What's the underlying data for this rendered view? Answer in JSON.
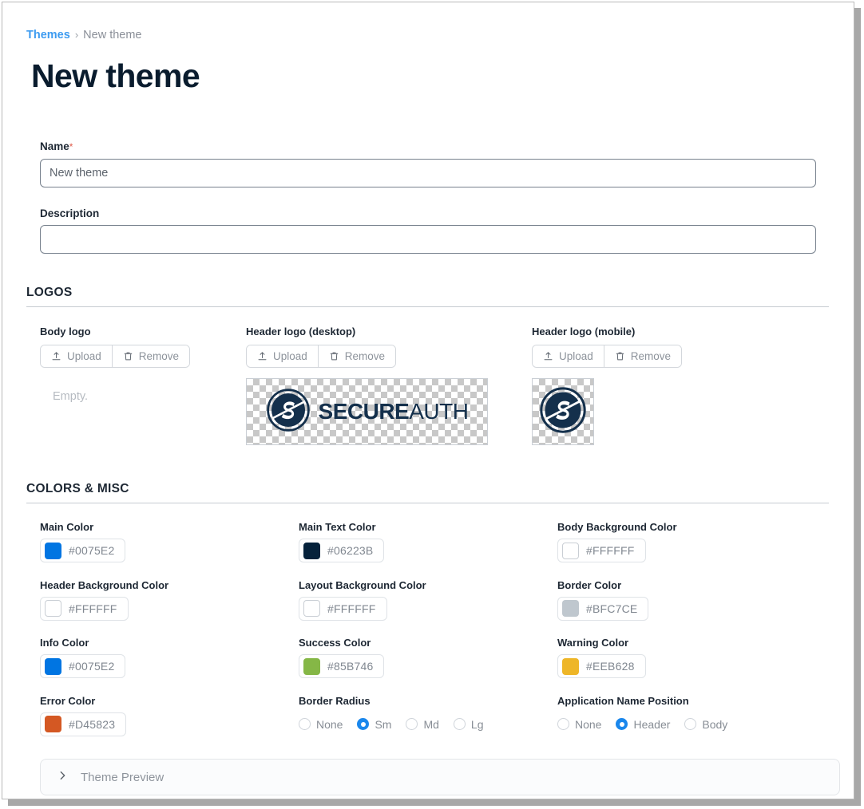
{
  "breadcrumb": {
    "link": "Themes",
    "separator": "›",
    "current": "New theme"
  },
  "page_title": "New theme",
  "form": {
    "name": {
      "label": "Name",
      "required_marker": "*",
      "value": "New theme",
      "placeholder": "New theme"
    },
    "description": {
      "label": "Description",
      "value": "",
      "placeholder": ""
    }
  },
  "logos_section": {
    "title": "LOGOS",
    "upload_label": "Upload",
    "remove_label": "Remove",
    "items": [
      {
        "label": "Body logo",
        "state": "Empty.",
        "preview": "none"
      },
      {
        "label": "Header logo (desktop)",
        "state": "",
        "preview": "wordmark"
      },
      {
        "label": "Header logo (mobile)",
        "state": "",
        "preview": "mark"
      }
    ],
    "wordmark": {
      "bold": "SECURE",
      "light": "AUTH",
      "color": "#14304C"
    }
  },
  "colors_section": {
    "title": "COLORS & MISC",
    "fields": [
      {
        "label": "Main Color",
        "value": "#0075E2",
        "swatch": "#0075E2"
      },
      {
        "label": "Main Text Color",
        "value": "#06223B",
        "swatch": "#06223B"
      },
      {
        "label": "Body Background Color",
        "value": "#FFFFFF",
        "swatch": "#FFFFFF"
      },
      {
        "label": "Header Background Color",
        "value": "#FFFFFF",
        "swatch": "#FFFFFF"
      },
      {
        "label": "Layout Background Color",
        "value": "#FFFFFF",
        "swatch": "#FFFFFF"
      },
      {
        "label": "Border Color",
        "value": "#BFC7CE",
        "swatch": "#BFC7CE"
      },
      {
        "label": "Info Color",
        "value": "#0075E2",
        "swatch": "#0075E2"
      },
      {
        "label": "Success Color",
        "value": "#85B746",
        "swatch": "#85B746"
      },
      {
        "label": "Warning Color",
        "value": "#EEB628",
        "swatch": "#EEB628"
      },
      {
        "label": "Error Color",
        "value": "#D45823",
        "swatch": "#D45823"
      }
    ],
    "border_radius": {
      "label": "Border Radius",
      "options": [
        "None",
        "Sm",
        "Md",
        "Lg"
      ],
      "selected": "Sm"
    },
    "app_name_position": {
      "label": "Application Name Position",
      "options": [
        "None",
        "Header",
        "Body"
      ],
      "selected": "Header"
    },
    "selected_radio_color": "#1A87EC"
  },
  "theme_preview": {
    "label": "Theme Preview",
    "expanded": false
  }
}
